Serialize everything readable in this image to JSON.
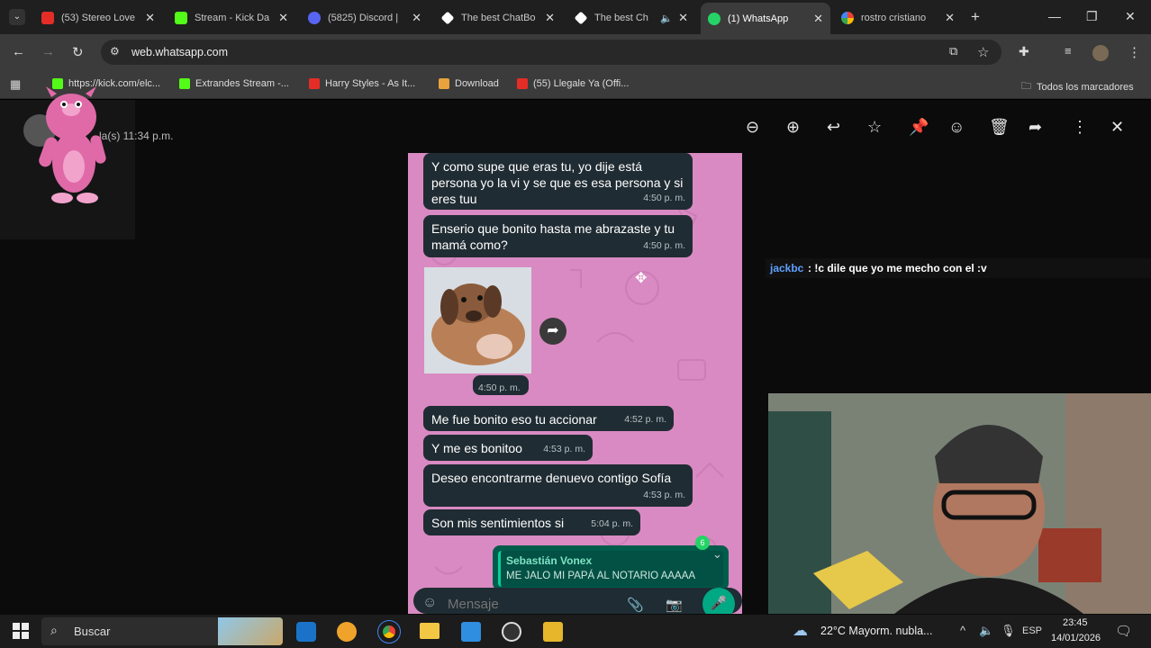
{
  "tabs": [
    {
      "title": "(53) Stereo Love",
      "favicon": "youtube-icon",
      "color": "#e52d27"
    },
    {
      "title": "Stream - Kick Da",
      "favicon": "kick-icon",
      "color": "#53fc18"
    },
    {
      "title": "(5825) Discord |",
      "favicon": "discord-icon",
      "color": "#5865f2"
    },
    {
      "title": "The best ChatBo",
      "favicon": "chatbot-icon",
      "color": "#ffffff"
    },
    {
      "title": "The best Ch",
      "favicon": "chatbot-icon",
      "color": "#ffffff"
    },
    {
      "title": "(1) WhatsApp",
      "favicon": "whatsapp-icon",
      "color": "#25d366"
    },
    {
      "title": "rostro cristiano",
      "favicon": "google-icon",
      "color": "#4285f4"
    }
  ],
  "address": {
    "url": "web.whatsapp.com"
  },
  "bookmarks": [
    {
      "label": "https://kick.com/elc...",
      "color": "#53fc18"
    },
    {
      "label": "Extrandes Stream -...",
      "color": "#53fc18"
    },
    {
      "label": "Harry Styles - As It...",
      "color": "#e52d27"
    },
    {
      "label": "Download",
      "color": "#e8a33d"
    },
    {
      "label": "(55) Llegale Ya (Offi...",
      "color": "#e52d27"
    }
  ],
  "bookmarks_all": "Todos los marcadores",
  "viewer": {
    "sender_time": "la(s) 11:34 p.m."
  },
  "messages": [
    {
      "text": "Y como supe que eras tu, yo dije está persona yo la vi y se que es esa persona y si eres tuu",
      "time": "4:50 p. m."
    },
    {
      "text": "Enserio que bonito hasta me abrazaste y tu mamá como?",
      "time": "4:50 p. m."
    },
    {
      "text": "",
      "time": "4:50 p. m."
    },
    {
      "text": "Me fue bonito eso tu accionar",
      "time": "4:52 p. m."
    },
    {
      "text": "Y me es bonitoo",
      "time": "4:53 p. m."
    },
    {
      "text": "Deseo encontrarme denuevo contigo Sofía",
      "time": "4:53 p. m."
    },
    {
      "text": "Son mis sentimientos si",
      "time": "5:04 p. m."
    }
  ],
  "reply": {
    "name": "Sebastián Vonex",
    "text": "ME JALO MI PAPÁ AL NOTARIO AAAAA",
    "badge": "6"
  },
  "composer": {
    "placeholder": "Mensaje"
  },
  "stream_chat": {
    "user": "jackbc",
    "text": ": !c dile que yo me mecho con el :v"
  },
  "taskbar": {
    "search": "Buscar",
    "weather": "22°C  Mayorm. nubla...",
    "lang": "ESP",
    "time": "23:45",
    "date": "14/01/2026"
  }
}
